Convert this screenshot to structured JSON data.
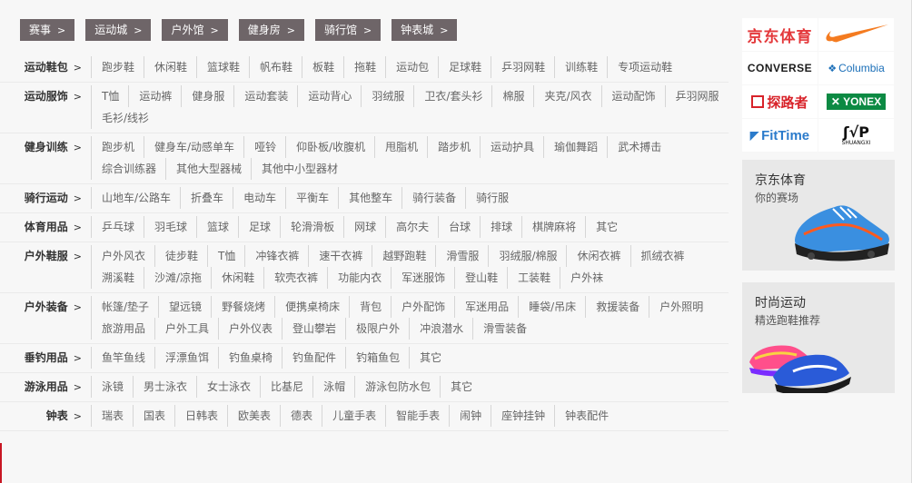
{
  "tags": [
    {
      "label": "赛事"
    },
    {
      "label": "运动城"
    },
    {
      "label": "户外馆"
    },
    {
      "label": "健身房"
    },
    {
      "label": "骑行馆"
    },
    {
      "label": "钟表城"
    }
  ],
  "arrow": ">",
  "categories": [
    {
      "title": "运动鞋包",
      "items": [
        "跑步鞋",
        "休闲鞋",
        "篮球鞋",
        "帆布鞋",
        "板鞋",
        "拖鞋",
        "运动包",
        "足球鞋",
        "乒羽网鞋",
        "训练鞋",
        "专项运动鞋"
      ]
    },
    {
      "title": "运动服饰",
      "items": [
        "T恤",
        "运动裤",
        "健身服",
        "运动套装",
        "运动背心",
        "羽绒服",
        "卫衣/套头衫",
        "棉服",
        "夹克/风衣",
        "运动配饰",
        "乒羽网服",
        "毛衫/线衫"
      ]
    },
    {
      "title": "健身训练",
      "items": [
        "跑步机",
        "健身车/动感单车",
        "哑铃",
        "仰卧板/收腹机",
        "甩脂机",
        "踏步机",
        "运动护具",
        "瑜伽舞蹈",
        "武术搏击",
        "综合训练器",
        "其他大型器械",
        "其他中小型器材"
      ]
    },
    {
      "title": "骑行运动",
      "items": [
        "山地车/公路车",
        "折叠车",
        "电动车",
        "平衡车",
        "其他整车",
        "骑行装备",
        "骑行服"
      ]
    },
    {
      "title": "体育用品",
      "items": [
        "乒乓球",
        "羽毛球",
        "篮球",
        "足球",
        "轮滑滑板",
        "网球",
        "高尔夫",
        "台球",
        "排球",
        "棋牌麻将",
        "其它"
      ]
    },
    {
      "title": "户外鞋服",
      "items": [
        "户外风衣",
        "徒步鞋",
        "T恤",
        "冲锋衣裤",
        "速干衣裤",
        "越野跑鞋",
        "滑雪服",
        "羽绒服/棉服",
        "休闲衣裤",
        "抓绒衣裤",
        "溯溪鞋",
        "沙滩/凉拖",
        "休闲鞋",
        "软壳衣裤",
        "功能内衣",
        "军迷服饰",
        "登山鞋",
        "工装鞋",
        "户外袜"
      ]
    },
    {
      "title": "户外装备",
      "items": [
        "帐篷/垫子",
        "望远镜",
        "野餐烧烤",
        "便携桌椅床",
        "背包",
        "户外配饰",
        "军迷用品",
        "睡袋/吊床",
        "救援装备",
        "户外照明",
        "旅游用品",
        "户外工具",
        "户外仪表",
        "登山攀岩",
        "极限户外",
        "冲浪潜水",
        "滑雪装备"
      ]
    },
    {
      "title": "垂钓用品",
      "items": [
        "鱼竿鱼线",
        "浮漂鱼饵",
        "钓鱼桌椅",
        "钓鱼配件",
        "钓箱鱼包",
        "其它"
      ]
    },
    {
      "title": "游泳用品",
      "items": [
        "泳镜",
        "男士泳衣",
        "女士泳衣",
        "比基尼",
        "泳帽",
        "游泳包防水包",
        "其它"
      ]
    },
    {
      "title": "钟表",
      "items": [
        "瑞表",
        "国表",
        "日韩表",
        "欧美表",
        "德表",
        "儿童手表",
        "智能手表",
        "闹钟",
        "座钟挂钟",
        "钟表配件"
      ]
    }
  ],
  "brands": {
    "jd": "京东体育",
    "nike": "nike-swoosh-logo",
    "converse": "CONVERSE",
    "columbia": "Columbia",
    "tanlu": "探路者",
    "yonex": "YONEX",
    "fittime": "FitTime",
    "shuangxi_caption": "SHUANGXI"
  },
  "promos": [
    {
      "title": "京东体育",
      "subtitle": "你的赛场"
    },
    {
      "title": "时尚运动",
      "subtitle": "精选跑鞋推荐"
    }
  ],
  "colors": {
    "tag_bg": "#6e6568",
    "nike_orange": "#f47b20",
    "jd_red": "#e4393c",
    "accent_red": "#c81623"
  }
}
